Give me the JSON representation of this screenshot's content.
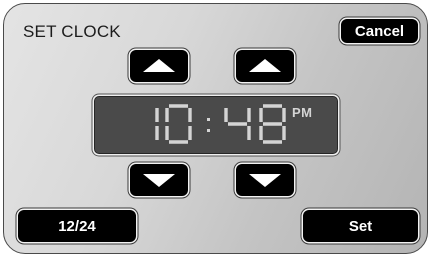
{
  "screen": {
    "title": "SET CLOCK"
  },
  "buttons": {
    "cancel_label": "Cancel",
    "format_label": "12/24",
    "set_label": "Set"
  },
  "clock": {
    "hour": "10",
    "minute": "48",
    "separator": ":",
    "period": "PM"
  },
  "icons": {
    "hour_up": "arrow-up-icon",
    "minute_up": "arrow-up-icon",
    "hour_down": "arrow-down-icon",
    "minute_down": "arrow-down-icon"
  },
  "colors": {
    "panel": "#d0d0d0",
    "button": "#000000",
    "display_background": "#4a4a4a",
    "display_digits": "#d4d4d4"
  }
}
